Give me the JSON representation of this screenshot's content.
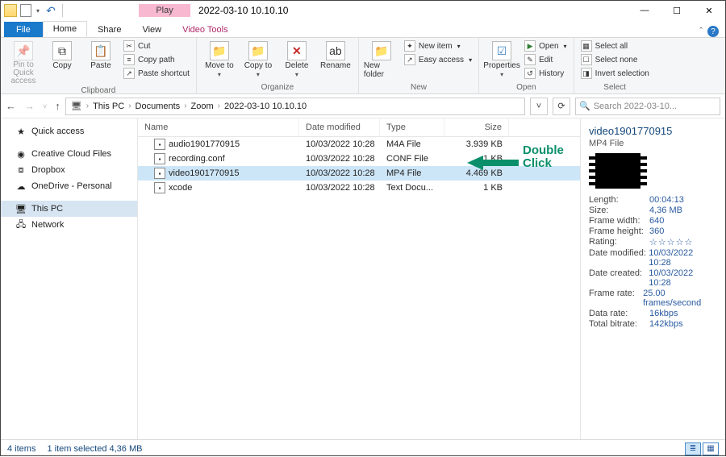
{
  "window": {
    "title": "2022-03-10 10.10.10",
    "play_tab": "Play"
  },
  "tabs": {
    "file": "File",
    "home": "Home",
    "share": "Share",
    "view": "View",
    "video": "Video Tools"
  },
  "ribbon": {
    "clipboard": {
      "label": "Clipboard",
      "pin": "Pin to Quick access",
      "copy": "Copy",
      "paste": "Paste",
      "cut": "Cut",
      "copy_path": "Copy path",
      "paste_shortcut": "Paste shortcut"
    },
    "organize": {
      "label": "Organize",
      "move_to": "Move to",
      "copy_to": "Copy to",
      "delete": "Delete",
      "rename": "Rename"
    },
    "new": {
      "label": "New",
      "new_folder": "New folder",
      "new_item": "New item",
      "easy_access": "Easy access"
    },
    "open": {
      "label": "Open",
      "properties": "Properties",
      "open": "Open",
      "edit": "Edit",
      "history": "History"
    },
    "select": {
      "label": "Select",
      "select_all": "Select all",
      "select_none": "Select none",
      "invert": "Invert selection"
    }
  },
  "breadcrumb": [
    "This PC",
    "Documents",
    "Zoom",
    "2022-03-10 10.10.10"
  ],
  "search": {
    "placeholder": "Search 2022-03-10..."
  },
  "sidebar": [
    {
      "label": "Quick access",
      "icon": "★"
    },
    {
      "label": "Creative Cloud Files",
      "icon": "◉"
    },
    {
      "label": "Dropbox",
      "icon": "⧈"
    },
    {
      "label": "OneDrive - Personal",
      "icon": "☁"
    },
    {
      "label": "This PC",
      "icon": "🖥",
      "selected": true
    },
    {
      "label": "Network",
      "icon": "🖧"
    }
  ],
  "columns": {
    "name": "Name",
    "date": "Date modified",
    "type": "Type",
    "size": "Size"
  },
  "files": [
    {
      "name": "audio1901770915",
      "date": "10/03/2022 10:28",
      "type": "M4A File",
      "size": "3.939 KB"
    },
    {
      "name": "recording.conf",
      "date": "10/03/2022 10:28",
      "type": "CONF File",
      "size": "1 KB"
    },
    {
      "name": "video1901770915",
      "date": "10/03/2022 10:28",
      "type": "MP4 File",
      "size": "4.469 KB",
      "selected": true
    },
    {
      "name": "xcode",
      "date": "10/03/2022 10:28",
      "type": "Text Docu...",
      "size": "1 KB"
    }
  ],
  "details": {
    "title": "video1901770915",
    "subtitle": "MP4 File",
    "meta": [
      {
        "k": "Length:",
        "v": "00:04:13"
      },
      {
        "k": "Size:",
        "v": "4,36 MB"
      },
      {
        "k": "Frame width:",
        "v": "640"
      },
      {
        "k": "Frame height:",
        "v": "360"
      },
      {
        "k": "Rating:",
        "v": "☆☆☆☆☆",
        "stars": true
      },
      {
        "k": "Date modified:",
        "v": "10/03/2022 10:28"
      },
      {
        "k": "Date created:",
        "v": "10/03/2022 10:28"
      },
      {
        "k": "Frame rate:",
        "v": "25.00 frames/second"
      },
      {
        "k": "Data rate:",
        "v": "16kbps"
      },
      {
        "k": "Total bitrate:",
        "v": "142kbps"
      }
    ]
  },
  "status": {
    "count": "4 items",
    "selected": "1 item selected  4,36 MB"
  },
  "annotation": "Double\nClick"
}
